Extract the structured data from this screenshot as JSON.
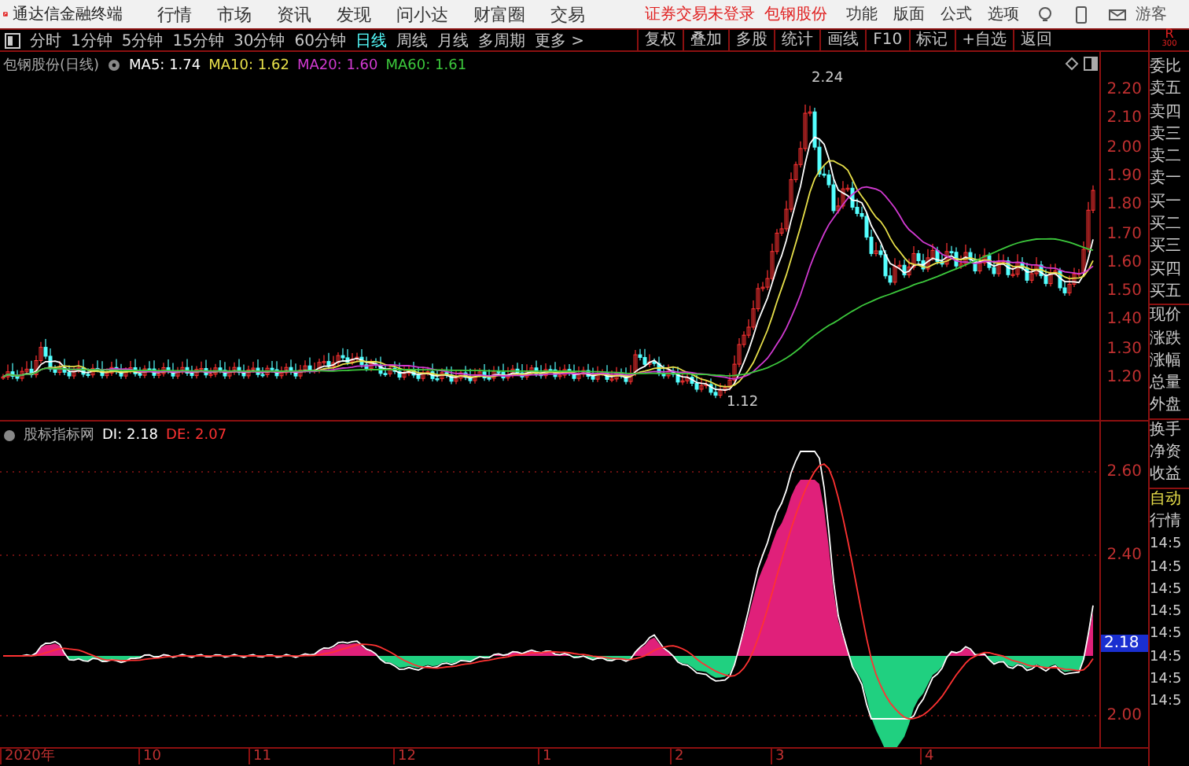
{
  "app": {
    "title": "通达信金融终端",
    "menus": [
      "行情",
      "市场",
      "资讯",
      "发现",
      "问小达",
      "财富圈",
      "交易"
    ],
    "notice": "证券交易未登录",
    "stock": "包钢股份",
    "tools": [
      "功能",
      "版面",
      "公式",
      "选项"
    ],
    "user": "游客"
  },
  "period_bar": {
    "periods": [
      {
        "label": "分时",
        "selected": false
      },
      {
        "label": "1分钟",
        "selected": false
      },
      {
        "label": "5分钟",
        "selected": false
      },
      {
        "label": "15分钟",
        "selected": false
      },
      {
        "label": "30分钟",
        "selected": false
      },
      {
        "label": "60分钟",
        "selected": false
      },
      {
        "label": "日线",
        "selected": true
      },
      {
        "label": "周线",
        "selected": false
      },
      {
        "label": "月线",
        "selected": false
      },
      {
        "label": "多周期",
        "selected": false
      }
    ],
    "more": "更多 >",
    "actions": [
      "复权",
      "叠加",
      "多股",
      "统计",
      "画线",
      "F10",
      "标记",
      "+自选",
      "返回"
    ],
    "corner": [
      "R",
      "300"
    ]
  },
  "main_chart": {
    "title": "包钢股份(日线)",
    "ma": [
      {
        "label": "MA5: 1.74",
        "color": "#ffffff"
      },
      {
        "label": "MA10: 1.62",
        "color": "#e8e04a"
      },
      {
        "label": "MA20: 1.60",
        "color": "#d23ad2"
      },
      {
        "label": "MA60: 1.61",
        "color": "#3cc83c"
      }
    ],
    "high_label": "2.24",
    "low_label": "1.12",
    "price_axis": [
      "2.20",
      "2.10",
      "2.00",
      "1.90",
      "1.80",
      "1.70",
      "1.60",
      "1.50",
      "1.40",
      "1.30",
      "1.20"
    ]
  },
  "indicator": {
    "title": "股标指标网",
    "values": [
      {
        "label": "DI: 2.18",
        "color": "#ffffff"
      },
      {
        "label": "DE: 2.07",
        "color": "#ff3232"
      }
    ],
    "axis": [
      "2.60",
      "2.40",
      "2.00"
    ],
    "current": "2.18"
  },
  "time_axis": [
    "2020年",
    "10",
    "11",
    "12",
    "1",
    "2",
    "3",
    "4"
  ],
  "quote_panel": {
    "labels": [
      "委比",
      "卖五",
      "卖四",
      "卖三",
      "卖二",
      "卖一",
      "买一",
      "买二",
      "买三",
      "买四",
      "买五",
      "现价",
      "涨跌",
      "涨幅",
      "总量",
      "外盘",
      "换手",
      "净资",
      "收益"
    ],
    "auto": "自动",
    "market": "行情",
    "times": [
      "14:5",
      "14:5",
      "14:5",
      "14:5",
      "14:5",
      "14:5",
      "14:5",
      "14:5"
    ]
  }
}
